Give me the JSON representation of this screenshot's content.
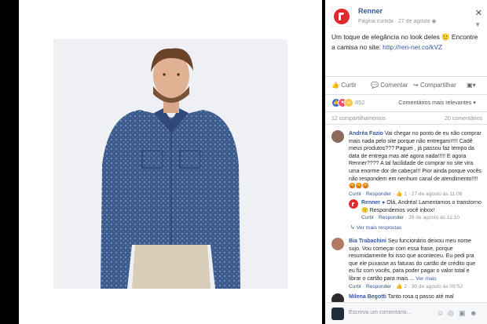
{
  "post": {
    "page_name": "Renner",
    "page_type": "Página curtida",
    "date": "27 de agosto",
    "text": "Um toque de elegância no look deles 🙂 Encontre a camisa no site: ",
    "link": "http://ren-ner.co/kVZ",
    "actions": {
      "like": "Curtir",
      "comment": "Comentar",
      "share": "Compartilhar"
    },
    "reaction_count": "852",
    "relevance": "Comentários mais relevantes",
    "shares": "12 compartilhamentos",
    "comments": "20 comentários"
  },
  "comments": [
    {
      "name": "Andréa Fazio",
      "text": "Vai chegar no ponto de eu não comprar mais nada pelo site porque não entregam!!!!! Cadê meus produtos??? Paguei , já passou faz tempo da data de entrega mas até agora nada!!!!! E agora Renner???? A tal facilidade de comprar no site vira uma enorme dor de cabeça!!! Pior ainda porque vocês não respondem em nenhum canal de atendimento!!!!",
      "emojis": "😡😡😡",
      "like": "Curtir",
      "reply": "Responder",
      "likes": "1",
      "time": "27 de agosto às 11:08"
    },
    {
      "name": "Renner",
      "text": "Olá, Andréa! Lamentamos o transtorno 🙁 Respondemos você inbox!",
      "like": "Curtir",
      "reply": "Responder",
      "time": "28 de agosto às 11:10"
    },
    {
      "more_replies": "Ver mais respostas"
    },
    {
      "name": "Bia Trabachini",
      "text": "Seu funcionário deixou meu nome sujo. Vou começar com essa frase, porque resumidamente foi isso que aconteceu. Eu pedi pra que ele puxasse as faturas do cartão de crédito que eu fiz com vocês, para poder pagar o valor total e librar o cartão para mais ...",
      "see_more": "Ver mais",
      "like": "Curtir",
      "reply": "Responder",
      "likes": "2",
      "time": "30 de agosto às 09:52"
    },
    {
      "name": "Milena Begotti",
      "text": "Tanto rosa q passo até mal"
    }
  ],
  "input": {
    "placeholder": "Escreva um comentário..."
  },
  "colors": {
    "link": "#365899",
    "brand_red": "#e0282d",
    "like_blue": "#3b70c7",
    "shirt": "#3b5a8d"
  }
}
